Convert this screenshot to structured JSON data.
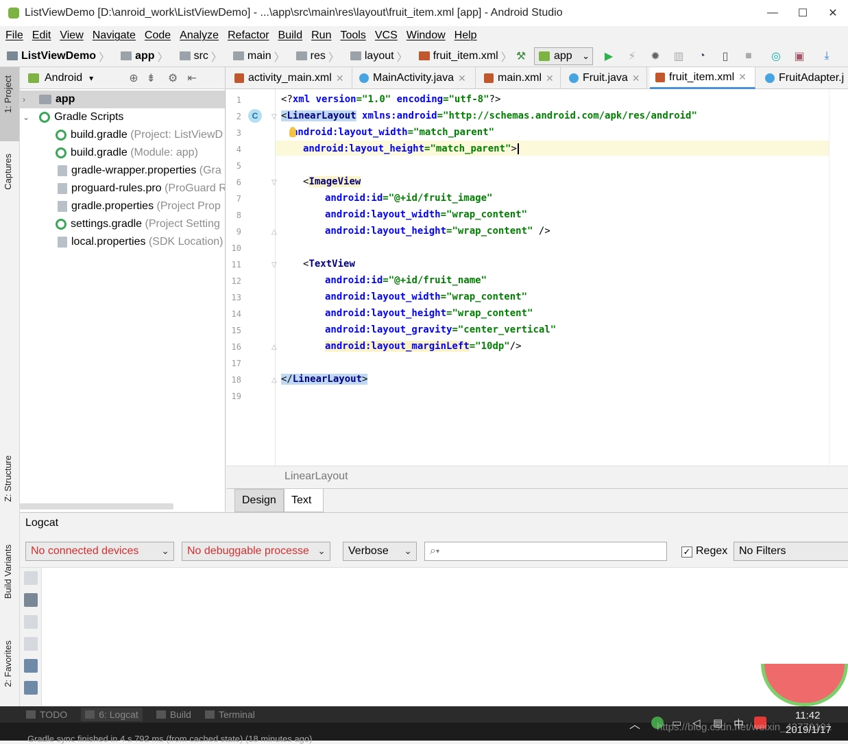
{
  "window": {
    "title": "ListViewDemo [D:\\anroid_work\\ListViewDemo] - ...\\app\\src\\main\\res\\layout\\fruit_item.xml [app] - Android Studio",
    "minimize": "—",
    "maximize": "☐",
    "close": "✕"
  },
  "menu": [
    "File",
    "Edit",
    "View",
    "Navigate",
    "Code",
    "Analyze",
    "Refactor",
    "Build",
    "Run",
    "Tools",
    "VCS",
    "Window",
    "Help"
  ],
  "breadcrumbs": [
    "ListViewDemo",
    "app",
    "src",
    "main",
    "res",
    "layout",
    "fruit_item.xml"
  ],
  "toolbar": {
    "run_config": "app"
  },
  "left_tool_tabs": [
    "1: Project",
    "Captures",
    "Z: Structure",
    "Build Variants",
    "2: Favorites"
  ],
  "project_panel": {
    "view_selector": "Android",
    "tree": [
      {
        "label": "app",
        "hint": ""
      },
      {
        "label": "Gradle Scripts",
        "hint": ""
      },
      {
        "label": "build.gradle",
        "hint": "(Project: ListViewD"
      },
      {
        "label": "build.gradle",
        "hint": "(Module: app)"
      },
      {
        "label": "gradle-wrapper.properties",
        "hint": "(Gra"
      },
      {
        "label": "proguard-rules.pro",
        "hint": "(ProGuard R"
      },
      {
        "label": "gradle.properties",
        "hint": "(Project Prop"
      },
      {
        "label": "settings.gradle",
        "hint": "(Project Setting"
      },
      {
        "label": "local.properties",
        "hint": "(SDK Location)"
      }
    ]
  },
  "editor_tabs": [
    {
      "label": "activity_main.xml"
    },
    {
      "label": "MainActivity.java"
    },
    {
      "label": "main.xml"
    },
    {
      "label": "Fruit.java"
    },
    {
      "label": "fruit_item.xml"
    },
    {
      "label": "FruitAdapter.j"
    }
  ],
  "code_lines": [
    "1",
    "2",
    "3",
    "4",
    "5",
    "6",
    "7",
    "8",
    "9",
    "10",
    "11",
    "12",
    "13",
    "14",
    "15",
    "16",
    "17",
    "18",
    "19"
  ],
  "code": {
    "l1": [
      "<?",
      "xml ",
      "version",
      "=",
      "\"1.0\"",
      "encoding",
      "=",
      "\"utf-8\"",
      "?>"
    ],
    "l2": [
      "<",
      "LinearLayout",
      " xmlns:android",
      "=",
      "\"http://schemas.android.com/apk/res/android\""
    ],
    "l3": [
      "android:layout_width",
      "=",
      "\"match_parent\""
    ],
    "l4": [
      "android:layout_height",
      "=",
      "\"match_parent\"",
      ">"
    ],
    "l6": [
      "<",
      "ImageView"
    ],
    "l7": [
      "android:id",
      "=",
      "\"@+id/fruit_image\""
    ],
    "l8": [
      "android:layout_width",
      "=",
      "\"wrap_content\""
    ],
    "l9": [
      "android:layout_height",
      "=",
      "\"wrap_content\"",
      " />"
    ],
    "l11": [
      "<",
      "TextView"
    ],
    "l12": [
      "android:id",
      "=",
      "\"@+id/fruit_name\""
    ],
    "l13": [
      "android:layout_width",
      "=",
      "\"wrap_content\""
    ],
    "l14": [
      "android:layout_height",
      "=",
      "\"wrap_content\""
    ],
    "l15": [
      "android:layout_gravity",
      "=",
      "\"center_vertical\""
    ],
    "l16": [
      "android:layout_marginLeft",
      "=",
      "\"10dp\"",
      "/>"
    ],
    "l18": [
      "</",
      "LinearLayout",
      ">"
    ]
  },
  "editor_breadcrumb": "LinearLayout",
  "design_tabs": {
    "design": "Design",
    "text": "Text"
  },
  "logcat": {
    "title": "Logcat",
    "device": "No connected devices",
    "process": "No debuggable processe",
    "level": "Verbose",
    "search_placeholder": "",
    "regex_label": "Regex",
    "filter": "No Filters"
  },
  "bottom_tool_windows": [
    "TODO",
    "6: Logcat",
    "Build",
    "Terminal"
  ],
  "status_text": "Gradle sync finished in 4 s 792 ms (from cached state) (18 minutes ago)",
  "taskbar": {
    "time": "11:42",
    "date": "2019/1/17",
    "watermark": "https://blog.csdn.net/weixin_43770191"
  },
  "colors": {
    "accent": "#4a90d9",
    "error_text": "#d32f2f",
    "run_green": "#2fb24b"
  }
}
